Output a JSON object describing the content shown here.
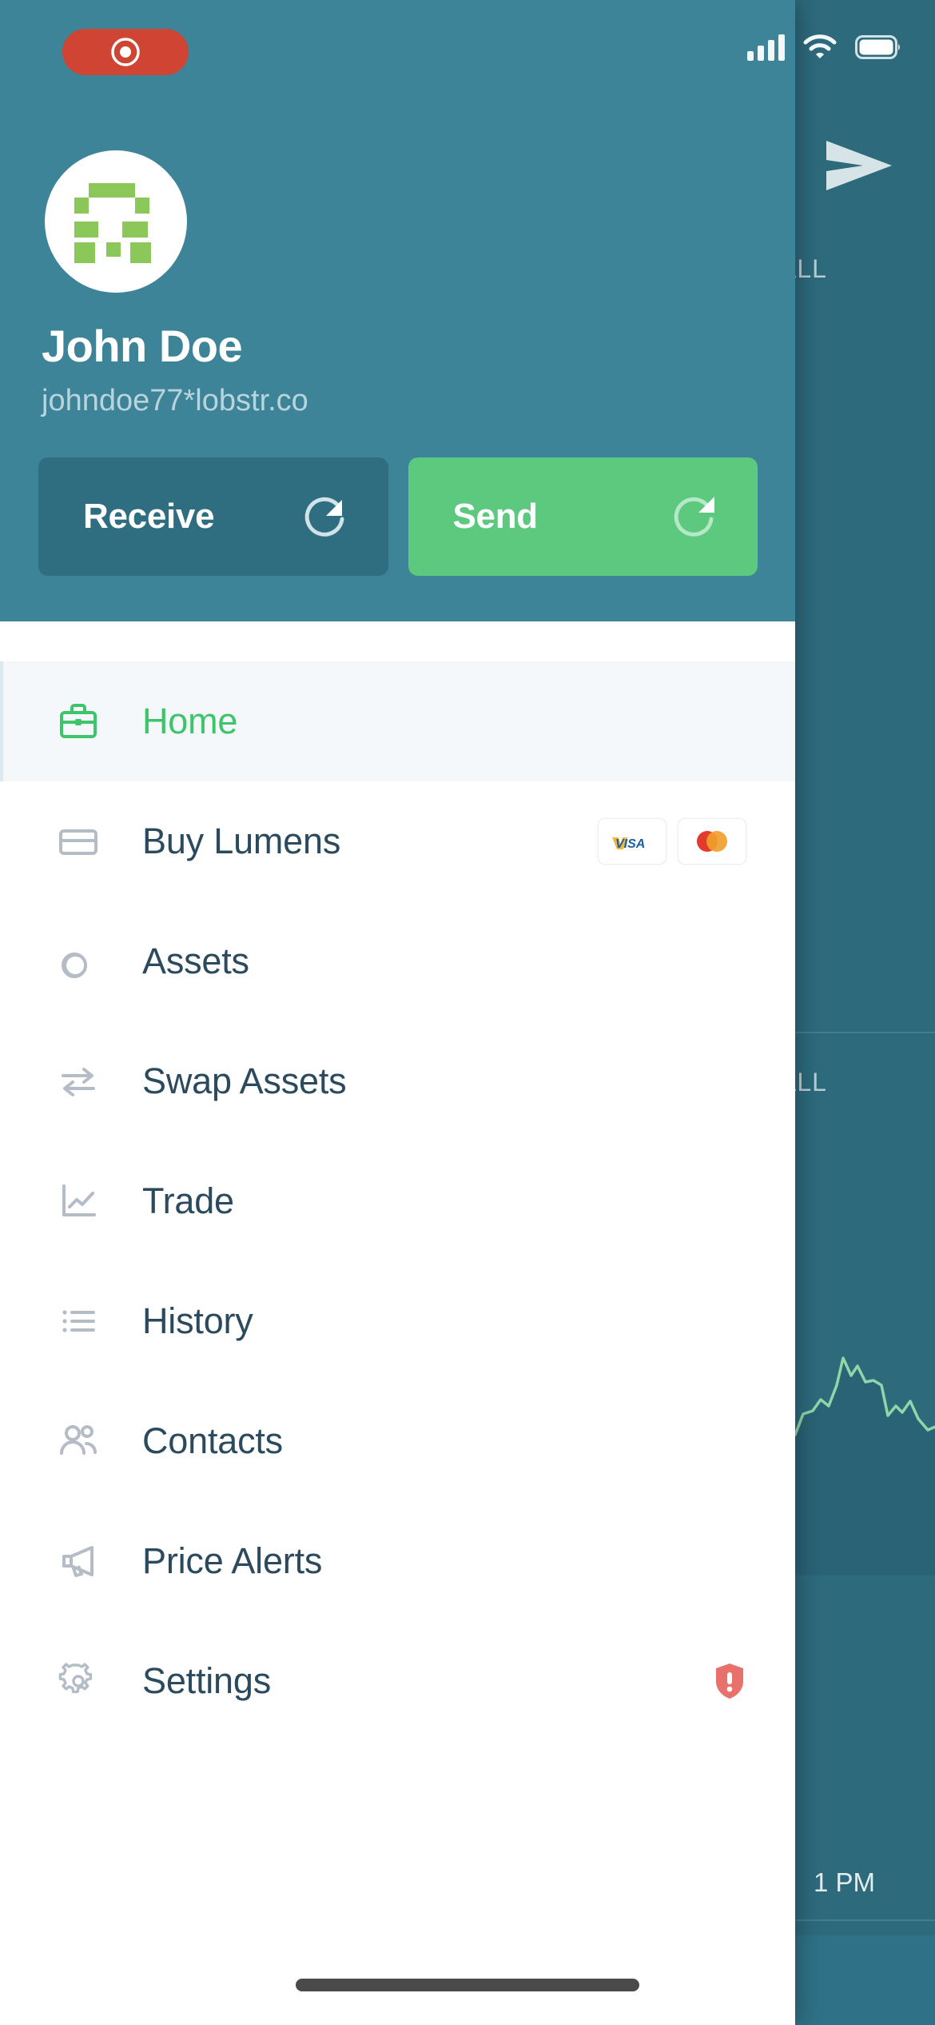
{
  "status_bar": {
    "recording_indicator": "recording-pill",
    "icons": [
      "cellular-signal-icon",
      "wifi-icon",
      "battery-icon"
    ]
  },
  "drawer": {
    "profile": {
      "avatar_icon": "pixel-avatar-icon",
      "name": "John Doe",
      "handle": "johndoe77*lobstr.co"
    },
    "actions": [
      {
        "label": "Receive",
        "icon": "arrow-in-circle-icon",
        "color": "#2f6e80"
      },
      {
        "label": "Send",
        "icon": "arrow-out-circle-icon",
        "color": "#5cc97f"
      }
    ],
    "menu": [
      {
        "label": "Home",
        "icon": "briefcase-icon",
        "active": true
      },
      {
        "label": "Buy Lumens",
        "icon": "credit-card-icon",
        "active": false,
        "badges": [
          "visa-icon",
          "mastercard-icon"
        ]
      },
      {
        "label": "Assets",
        "icon": "coins-icon",
        "active": false
      },
      {
        "label": "Swap Assets",
        "icon": "swap-arrows-icon",
        "active": false
      },
      {
        "label": "Trade",
        "icon": "line-chart-icon",
        "active": false
      },
      {
        "label": "History",
        "icon": "list-icon",
        "active": false
      },
      {
        "label": "Contacts",
        "icon": "people-icon",
        "active": false
      },
      {
        "label": "Price Alerts",
        "icon": "megaphone-icon",
        "active": false
      },
      {
        "label": "Settings",
        "icon": "gear-icon",
        "active": false,
        "warning": "warning-shield-icon"
      }
    ]
  },
  "background_app": {
    "send_icon": "paper-plane-icon",
    "range_label_top": "ALL",
    "range_label_bottom": "ALL",
    "time_label": "1 PM",
    "chart_line_color": "#8fd6a8"
  },
  "colors": {
    "header_teal": "#3d8499",
    "dim_teal": "#2d6a7c",
    "accent_green": "#3ec46b",
    "send_green": "#5cc97f",
    "receive_teal": "#2f6e80",
    "text_dark": "#2c4a5e",
    "active_row_bg": "#f4f8fa",
    "warning_red": "#e8716b",
    "record_red": "#cf4433"
  }
}
